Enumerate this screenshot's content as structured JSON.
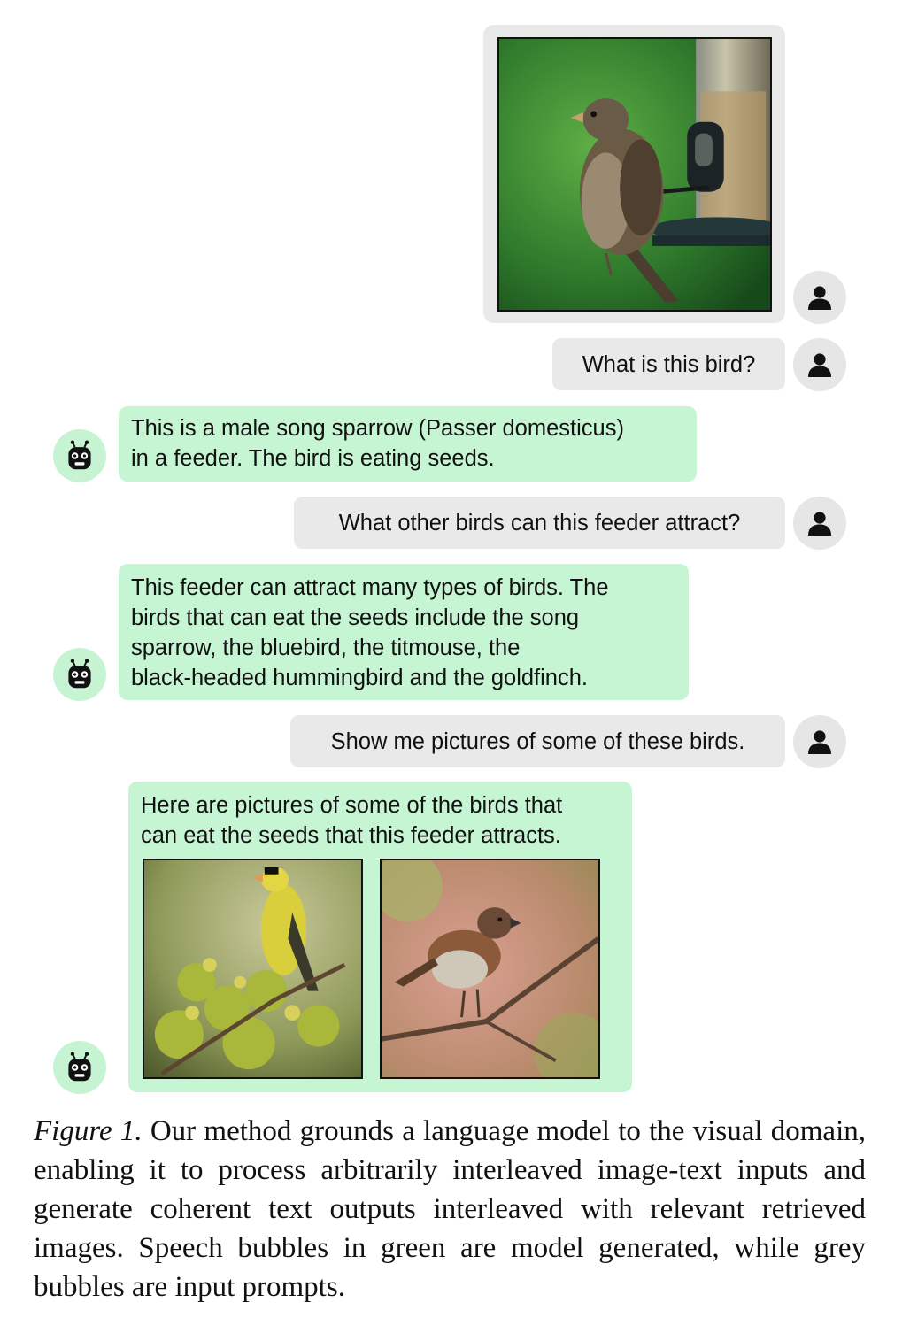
{
  "conversation": {
    "user_image_alt": "sparrow on a bird feeder",
    "prompt_1": "What is this bird?",
    "response_1": "This is a male song sparrow (Passer domesticus)\nin a feeder. The bird is eating seeds.",
    "prompt_2": "What other birds can this feeder attract?",
    "response_2": "This feeder can attract many types of birds. The\nbirds that can eat the seeds include the song\nsparrow, the bluebird, the titmouse, the\nblack-headed hummingbird and the goldfinch.",
    "prompt_3": "Show me pictures of some of these birds.",
    "response_3": "Here are pictures of some of the birds that\ncan eat the seeds that this feeder attracts.",
    "retrieved_images": [
      "goldfinch on a branch",
      "sparrow on a branch"
    ]
  },
  "icons": {
    "user": "user-icon",
    "bot": "robot-icon"
  },
  "colors": {
    "model_bubble": "#c6f5d3",
    "input_bubble": "#e9e9e9"
  },
  "caption": {
    "label": "Figure 1.",
    "text": "Our method grounds a language model to the visual domain, enabling it to process arbitrarily interleaved image-text inputs and generate coherent text outputs interleaved with relevant retrieved images. Speech bubbles in green are model generated, while grey bubbles are input prompts."
  }
}
